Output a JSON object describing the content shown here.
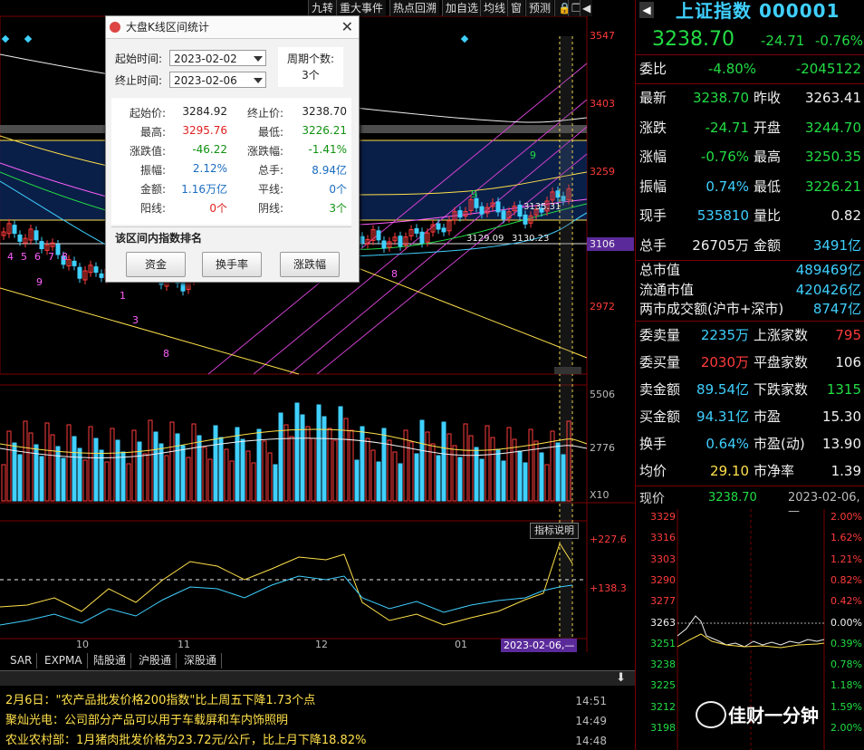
{
  "toolbar": {
    "buttons": [
      "九转",
      "重大事件",
      "热点回溯",
      "加自选",
      "均线",
      "窗",
      "预测"
    ],
    "icons": [
      "lock-icon",
      "window-restore-icon",
      "back-icon"
    ]
  },
  "main_chart": {
    "price_axis": [
      "3547",
      "3403",
      "3259",
      "3106",
      "2972"
    ],
    "current_price_tag": "3106",
    "inline_labels": [
      "3135.31",
      "3129.09",
      "3130.23"
    ],
    "nine_turn_marks": [
      "4",
      "5",
      "6",
      "7",
      "8",
      "9",
      "1",
      "2",
      "3"
    ],
    "volume_axis": [
      "5506",
      "2776"
    ],
    "volume_scale": "X10",
    "indicator_axis": [
      "+227.6",
      "+138.3"
    ],
    "indicator_button": "指标说明",
    "x_axis": [
      "10",
      "11",
      "12",
      "01"
    ],
    "cursor_date": "2023-02-06,—"
  },
  "dialog": {
    "title": "大盘K线区间统计",
    "start_label": "起始时间:",
    "start_value": "2023-02-02",
    "end_label": "终止时间:",
    "end_value": "2023-02-06",
    "period_label": "周期个数:",
    "period_value": "3个",
    "stats": [
      {
        "l1": "起始价:",
        "v1": "3284.92",
        "c1": "#222",
        "l2": "终止价:",
        "v2": "3238.70",
        "c2": "#222"
      },
      {
        "l1": "最高:",
        "v1": "3295.76",
        "c1": "#e02020",
        "l2": "最低:",
        "v2": "3226.21",
        "c2": "#109010"
      },
      {
        "l1": "涨跌值:",
        "v1": "-46.22",
        "c1": "#109010",
        "l2": "涨跌幅:",
        "v2": "-1.41%",
        "c2": "#109010"
      },
      {
        "l1": "振幅:",
        "v1": "2.12%",
        "c1": "#1a6cc0",
        "l2": "总手:",
        "v2": "8.94亿",
        "c2": "#1a6cc0"
      },
      {
        "l1": "金额:",
        "v1": "1.16万亿",
        "c1": "#1a6cc0",
        "l2": "平线:",
        "v2": "0个",
        "c2": "#1a6cc0"
      },
      {
        "l1": "阳线:",
        "v1": "0个",
        "c1": "#e02020",
        "l2": "阴线:",
        "v2": "3个",
        "c2": "#109010"
      }
    ],
    "rank_title": "该区间内指数排名",
    "buttons": [
      "资金",
      "换手率",
      "涨跌幅"
    ]
  },
  "quote": {
    "name": "上证指数",
    "code": "000001",
    "price": "3238.70",
    "change": "-24.71",
    "change_pct": "-0.76%",
    "weibi_label": "委比",
    "weibi_pct": "-4.80%",
    "weibi_value": "-2045122",
    "rows1": [
      {
        "l1": "最新",
        "v1": "3238.70",
        "c1": "#22dd44",
        "l2": "昨收",
        "v2": "3263.41",
        "c2": "#f0f0f0"
      },
      {
        "l1": "涨跌",
        "v1": "-24.71",
        "c1": "#22dd44",
        "l2": "开盘",
        "v2": "3244.70",
        "c2": "#22dd44"
      },
      {
        "l1": "涨幅",
        "v1": "-0.76%",
        "c1": "#22dd44",
        "l2": "最高",
        "v2": "3250.35",
        "c2": "#22dd44"
      },
      {
        "l1": "振幅",
        "v1": "0.74%",
        "c1": "#3fd0ff",
        "l2": "最低",
        "v2": "3226.21",
        "c2": "#22dd44"
      },
      {
        "l1": "现手",
        "v1": "535810",
        "c1": "#3fd0ff",
        "l2": "量比",
        "v2": "0.82",
        "c2": "#f0f0f0"
      },
      {
        "l1": "总手",
        "v1": "26705万",
        "c1": "#f0f0f0",
        "l2": "金额",
        "v2": "3491亿",
        "c2": "#3fd0ff"
      }
    ],
    "rows2": [
      {
        "l": "总市值",
        "v": "489469亿"
      },
      {
        "l": "流通市值",
        "v": "420426亿"
      },
      {
        "l": "两市成交额(沪市+深市)",
        "v": "8747亿"
      }
    ],
    "rows3": [
      {
        "l1": "委卖量",
        "v1": "2235万",
        "c1": "#3fd0ff",
        "l2": "上涨家数",
        "v2": "795",
        "c2": "#ff3b3b"
      },
      {
        "l1": "委买量",
        "v1": "2030万",
        "c1": "#ff3b3b",
        "l2": "平盘家数",
        "v2": "106",
        "c2": "#f0f0f0"
      },
      {
        "l1": "卖金额",
        "v1": "89.54亿",
        "c1": "#3fd0ff",
        "l2": "下跌家数",
        "v2": "1315",
        "c2": "#22dd44"
      },
      {
        "l1": "买金额",
        "v1": "94.31亿",
        "c1": "#3fd0ff",
        "l2": "市盈",
        "v2": "15.30",
        "c2": "#f0f0f0"
      },
      {
        "l1": "换手",
        "v1": "0.64%",
        "c1": "#3fd0ff",
        "l2": "市盈(动)",
        "v2": "13.90",
        "c2": "#f0f0f0"
      },
      {
        "l1": "均价",
        "v1": "29.10",
        "c1": "#ffe04a",
        "l2": "市净率",
        "v2": "1.39",
        "c2": "#f0f0f0"
      }
    ],
    "mini_header": {
      "label": "现价",
      "price": "3238.70",
      "date": "2023-02-06,—"
    },
    "mini_left": [
      "3329",
      "3316",
      "3303",
      "3290",
      "3277",
      "3263",
      "3251",
      "3238",
      "3225",
      "3212",
      "3198"
    ],
    "mini_right": [
      "2.00%",
      "1.62%",
      "1.21%",
      "0.82%",
      "0.42%",
      "0.00%",
      "0.39%",
      "0.78%",
      "1.18%",
      "1.59%",
      "2.00%"
    ]
  },
  "tabs": [
    "SAR",
    "EXPMA",
    "陆股通",
    "沪股通",
    "深股通"
  ],
  "news": [
    {
      "text": "2月6日：\"农产品批发价格200指数\"比上周五下降1.73个点",
      "time": "14:51"
    },
    {
      "text": "聚灿光电：公司部分产品可以用于车载屏和车内饰照明",
      "time": "14:49"
    },
    {
      "text": "农业农村部：1月猪肉批发价格为23.72元/公斤，比上月下降18.82%",
      "time": "14:48"
    }
  ],
  "watermark": "佳财一分钟",
  "colors": {
    "up": "#ff3b3b",
    "down": "#22dd44",
    "bg": "#000000",
    "accent": "#3fd0ff"
  }
}
